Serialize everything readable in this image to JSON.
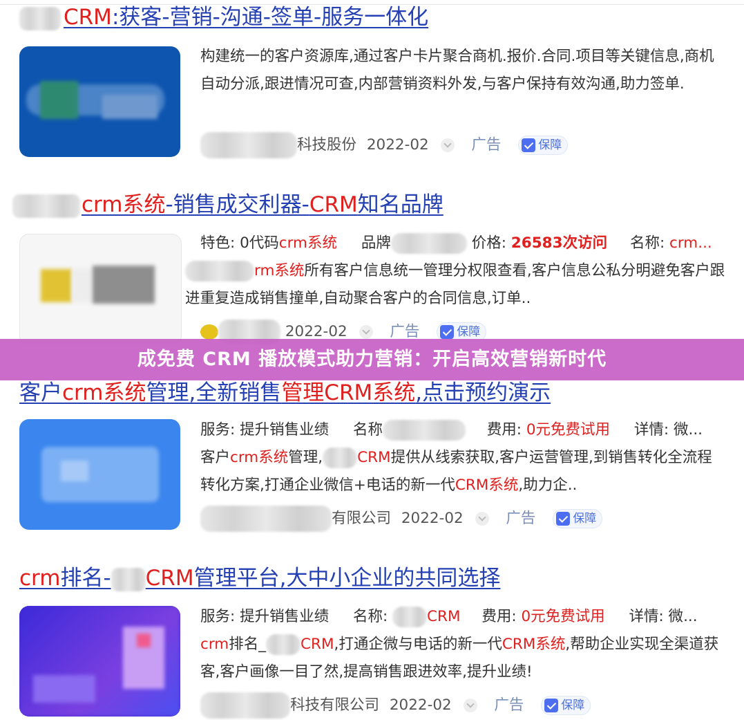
{
  "results": [
    {
      "title_hl_1": "CRM",
      "title_1": ":获客-营销-沟通-签单-服务一体化",
      "description": "构建统一的客户资源库,通过客户卡片聚合商机.报价.合同.项目等关键信息,商机自动分派,跟进情况可查,内部营销资料外发,与客户保持有效沟通,助力签单.",
      "source": "科技股份",
      "date": "2022-02",
      "ad_label": "广告",
      "badge_label": "保障"
    },
    {
      "title_hl_1": "crm系统",
      "title_1": "-销售成交利器-",
      "title_hl_2": "CRM",
      "title_2": "知名品牌",
      "meta_feature_label": "特色: 0代码",
      "meta_feature_hl": "crm系统",
      "meta_brand_label": "品牌",
      "meta_price_label": "价格: ",
      "meta_price_value": "26583次访问",
      "meta_name_label": "名称: ",
      "meta_name_value": "crm...",
      "desc_hl": "rm系统",
      "description": "所有客户信息统一管理分权限查看,客户信息公私分明避免客户跟进重复造成销售撞单,自动聚合客户的合同信息,订单..",
      "date": "2022-02",
      "ad_label": "广告",
      "badge_label": "保障"
    },
    {
      "title_1": "客户",
      "title_hl_1": "crm系统",
      "title_2": "管理,全新销售",
      "title_hl_2": "管理CRM系统",
      "title_3": ",点击预约演示",
      "meta_service": "服务: 提升销售业绩",
      "meta_name_label": "名称",
      "meta_fee_label": "费用: ",
      "meta_fee_value": "0元免费试用",
      "meta_detail": "详情: 微...",
      "desc_1": "客户",
      "desc_hl_1": "crm系统",
      "desc_2": "管理,",
      "desc_hl_2": "CRM",
      "desc_3": "提供从线索获取,客户运营管理,到销售转化全流程转化方案,打通企业微信+电话的新一代",
      "desc_hl_3": "CRM系统",
      "desc_4": ",助力企..",
      "source": "有限公司",
      "date": "2022-02",
      "ad_label": "广告",
      "badge_label": "保障"
    },
    {
      "title_hl_1": "crm",
      "title_1": "排名-",
      "title_hl_2": "CRM",
      "title_2": "管理平台,大中小企业的共同选择",
      "meta_service": "服务: 提升销售业绩",
      "meta_name_label": "名称: ",
      "meta_name_value": "CRM",
      "meta_fee_label": "费用: ",
      "meta_fee_value": "0元免费试用",
      "meta_detail": "详情: 微...",
      "desc_hl_1": "crm",
      "desc_1": "排名_",
      "desc_hl_2": "CRM",
      "desc_2": ",打通企微与电话的新一代",
      "desc_hl_3": "CRM系统",
      "desc_3": ",帮助企业实现全渠道获客,客户画像一目了然,提高销售跟进效率,提升业绩!",
      "source": "科技有限公司",
      "date": "2022-02",
      "ad_label": "广告",
      "badge_label": "保障"
    }
  ],
  "banner": {
    "text": "成免费 CRM 播放模式助力营销：开启高效营销新时代"
  }
}
